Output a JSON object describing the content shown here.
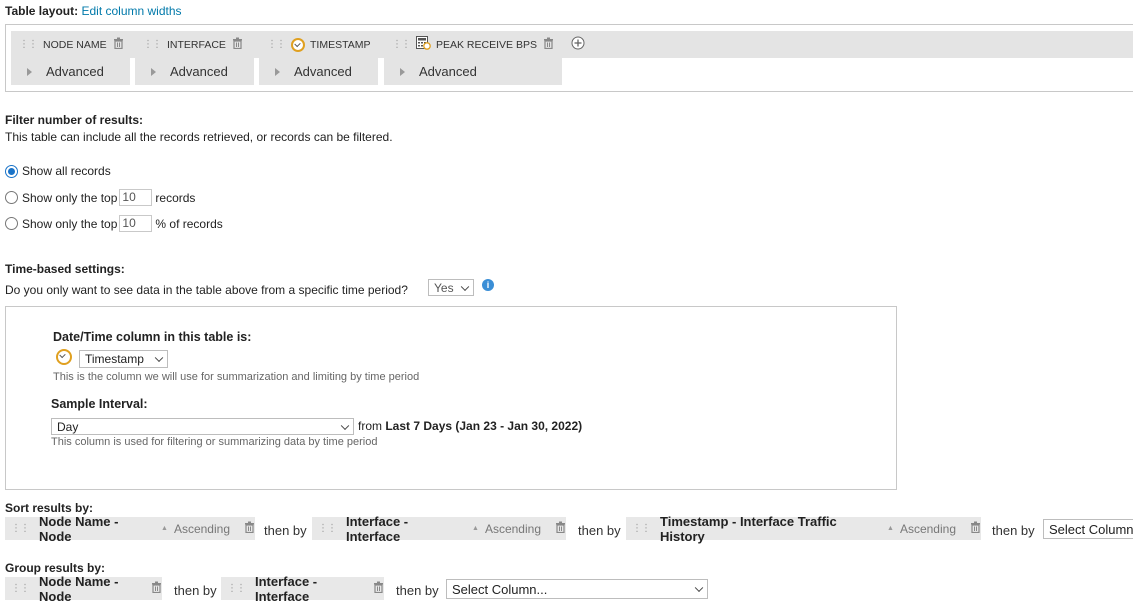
{
  "table_layout": {
    "label": "Table layout:",
    "edit_link": "Edit column widths",
    "columns": [
      {
        "name": "NODE NAME",
        "advanced": "Advanced"
      },
      {
        "name": "INTERFACE",
        "advanced": "Advanced"
      },
      {
        "name": "TIMESTAMP",
        "advanced": "Advanced"
      },
      {
        "name": "PEAK RECEIVE BPS",
        "advanced": "Advanced"
      }
    ]
  },
  "filter": {
    "heading": "Filter number of results:",
    "description": "This table can include all the records retrieved, or records can be filtered.",
    "options": [
      {
        "label": "Show all records",
        "selected": true
      },
      {
        "prefix": "Show only the top",
        "value": "10",
        "suffix": "records",
        "selected": false
      },
      {
        "prefix": "Show only the top",
        "value": "10",
        "suffix": "% of records",
        "selected": false
      }
    ]
  },
  "time_settings": {
    "heading": "Time-based settings:",
    "question": "Do you only want to see data in the table above from a specific time period?",
    "answer": "Yes",
    "datetime_label": "Date/Time column in this table is:",
    "datetime_value": "Timestamp",
    "datetime_hint": "This is the column we will use for summarization and limiting by time period",
    "interval_label": "Sample Interval:",
    "interval_value": "Day",
    "from_text": "from",
    "range_text": "Last 7 Days (Jan 23 - Jan 30, 2022)",
    "interval_hint": "This column is used for filtering or summarizing data by time period"
  },
  "sort": {
    "heading": "Sort results by:",
    "then_by": "then by",
    "items": [
      {
        "name": "Node Name - Node",
        "order": "Ascending"
      },
      {
        "name": "Interface - Interface",
        "order": "Ascending"
      },
      {
        "name": "Timestamp - Interface Traffic History",
        "order": "Ascending"
      }
    ],
    "select_placeholder": "Select Column..."
  },
  "group": {
    "heading": "Group results by:",
    "then_by": "then by",
    "items": [
      {
        "name": "Node Name - Node"
      },
      {
        "name": "Interface - Interface"
      }
    ],
    "select_placeholder": "Select Column..."
  }
}
